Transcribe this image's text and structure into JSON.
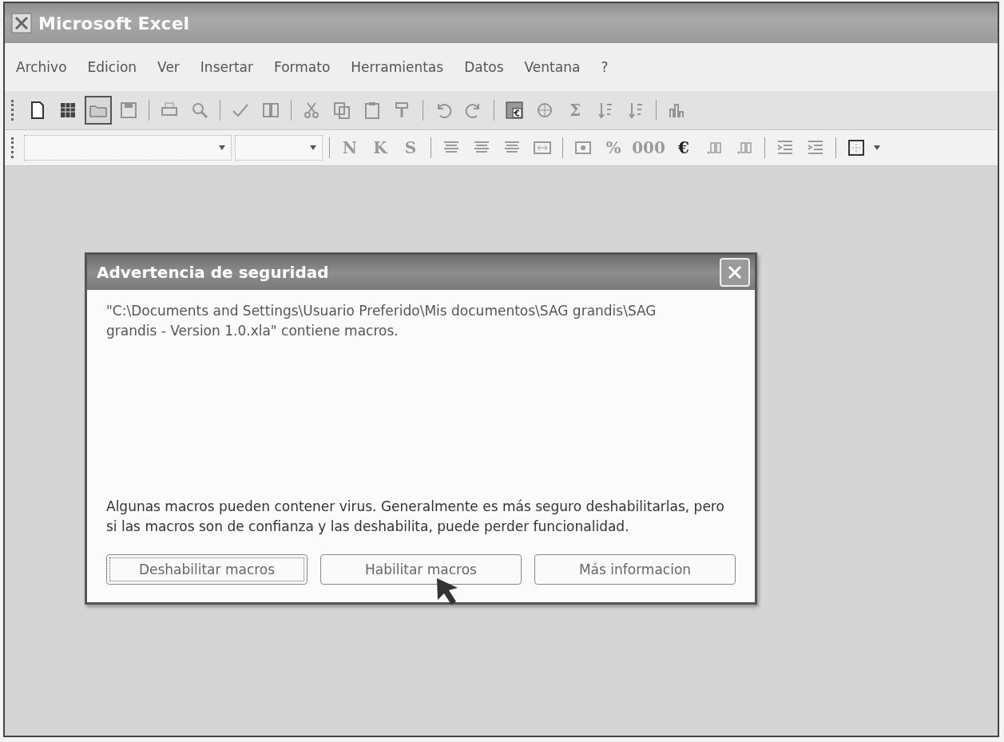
{
  "window": {
    "title": "Microsoft Excel"
  },
  "menu": [
    {
      "label": "Archivo"
    },
    {
      "label": "Edicion"
    },
    {
      "label": "Ver"
    },
    {
      "label": "Insertar"
    },
    {
      "label": "Formato"
    },
    {
      "label": "Herramientas"
    },
    {
      "label": "Datos"
    },
    {
      "label": "Ventana"
    },
    {
      "label": "?"
    }
  ],
  "standard_toolbar": [
    {
      "kind": "new",
      "disabled": false,
      "highlighted": false
    },
    {
      "kind": "grid",
      "disabled": false,
      "highlighted": false
    },
    {
      "kind": "open",
      "disabled": false,
      "highlighted": true
    },
    {
      "kind": "save",
      "disabled": true,
      "highlighted": false
    },
    {
      "kind": "separator"
    },
    {
      "kind": "print",
      "disabled": true,
      "highlighted": false
    },
    {
      "kind": "preview",
      "disabled": true,
      "highlighted": false
    },
    {
      "kind": "separator"
    },
    {
      "kind": "spelling",
      "disabled": true,
      "highlighted": false
    },
    {
      "kind": "research",
      "disabled": true,
      "highlighted": false
    },
    {
      "kind": "separator"
    },
    {
      "kind": "cut",
      "disabled": true,
      "highlighted": false
    },
    {
      "kind": "copy",
      "disabled": true,
      "highlighted": false
    },
    {
      "kind": "paste",
      "disabled": true,
      "highlighted": false
    },
    {
      "kind": "painter",
      "disabled": true,
      "highlighted": false
    },
    {
      "kind": "separator"
    },
    {
      "kind": "undo",
      "disabled": true,
      "highlighted": false
    },
    {
      "kind": "redo",
      "disabled": true,
      "highlighted": false
    },
    {
      "kind": "separator"
    },
    {
      "kind": "euro",
      "disabled": false,
      "highlighted": false
    },
    {
      "kind": "hyperlink",
      "disabled": true,
      "highlighted": false
    },
    {
      "kind": "text",
      "label": "Σ",
      "disabled": true,
      "highlighted": false
    },
    {
      "kind": "sort",
      "disabled": true,
      "highlighted": false
    },
    {
      "kind": "sort",
      "disabled": true,
      "highlighted": false
    },
    {
      "kind": "separator"
    },
    {
      "kind": "chart",
      "disabled": true,
      "highlighted": false
    }
  ],
  "format_toolbar": [
    {
      "kind": "combo",
      "wide": true
    },
    {
      "kind": "combo",
      "wide": false
    },
    {
      "kind": "separator"
    },
    {
      "kind": "text",
      "label": "N",
      "disabled": true
    },
    {
      "kind": "text",
      "label": "K",
      "disabled": true
    },
    {
      "kind": "text",
      "label": "S",
      "disabled": true
    },
    {
      "kind": "separator"
    },
    {
      "kind": "align",
      "disabled": true
    },
    {
      "kind": "align",
      "disabled": true
    },
    {
      "kind": "align",
      "disabled": true
    },
    {
      "kind": "merge",
      "disabled": true
    },
    {
      "kind": "separator"
    },
    {
      "kind": "currency",
      "disabled": true
    },
    {
      "kind": "text",
      "label": "%",
      "disabled": true
    },
    {
      "kind": "text",
      "label": "000",
      "disabled": true
    },
    {
      "kind": "text",
      "label": "€",
      "disabled": false
    },
    {
      "kind": "decimal",
      "disabled": true
    },
    {
      "kind": "decimal",
      "disabled": true
    },
    {
      "kind": "separator"
    },
    {
      "kind": "indent",
      "disabled": true
    },
    {
      "kind": "indent",
      "disabled": true
    },
    {
      "kind": "separator"
    },
    {
      "kind": "border",
      "disabled": false
    }
  ],
  "dialog": {
    "title": "Advertencia de seguridad",
    "message": "\"C:\\Documents and Settings\\Usuario Preferido\\Mis documentos\\SAG grandis\\SAG grandis - Version 1.0.xla\" contiene macros.",
    "warning": "Algunas macros pueden contener virus. Generalmente es más seguro deshabilitarlas, pero si las macros son de confianza y las deshabilita, puede perder funcionalidad.",
    "buttons": [
      {
        "label": "Deshabilitar macros",
        "focused": true
      },
      {
        "label": "Habilitar macros",
        "focused": false
      },
      {
        "label": "Más informacion",
        "focused": false
      }
    ]
  }
}
